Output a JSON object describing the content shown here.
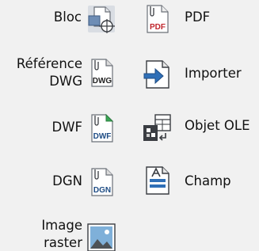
{
  "tools": {
    "bloc": {
      "label": "Bloc"
    },
    "pdf": {
      "label": "PDF"
    },
    "ref_dwg": {
      "line1": "Référence",
      "line2": "DWG",
      "icon_text": "DWG"
    },
    "importer": {
      "label": "Importer"
    },
    "dwf": {
      "label": "DWF",
      "icon_text": "DWF"
    },
    "ole": {
      "label": "Objet OLE"
    },
    "dgn": {
      "label": "DGN",
      "icon_text": "DGN"
    },
    "champ": {
      "label": "Champ"
    },
    "image": {
      "line1": "Image",
      "line2": "raster"
    }
  },
  "pdf_icon_text": "PDF",
  "colors": {
    "background": "#f1f1f1",
    "text": "#111111",
    "icon_blue": "#2f6fb7",
    "icon_red": "#c0262d",
    "icon_dark": "#3a3d42",
    "icon_green": "#3aa655"
  }
}
